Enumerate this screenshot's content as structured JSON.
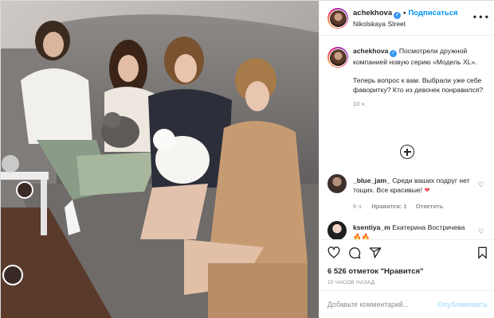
{
  "post": {
    "username": "achekhova",
    "follow_label": "Подписаться",
    "separator": "•",
    "location": "Nikolskaya Street",
    "more_label": "• • •"
  },
  "caption": {
    "username": "achekhova",
    "text1": "Посмотрели дружной компанией новую серию «Модель XL».",
    "text2": "Теперь вопрос к вам. Выбрали уже себе фаворитку? Кто из девочек понравился?",
    "time": "10 ч."
  },
  "comments": [
    {
      "username": "_blue_jam_",
      "text": "Среди ваших подруг нет тощих. Все красивые!",
      "emoji": "❤",
      "time": "6 ч.",
      "likes": "Нравится: 1",
      "reply": "Ответить"
    },
    {
      "username": "ksentiya_m",
      "text": "Екатерина Востричева",
      "emoji": "🔥🔥"
    }
  ],
  "actions": {
    "likes_text": "6 526 отметок \"Нравится\"",
    "time_ago": "10 ЧАСОВ НАЗАД"
  },
  "add_comment": {
    "placeholder": "Добавьте комментарий...",
    "post_label": "Опубликовать"
  },
  "colors": {
    "accent": "#0095f6",
    "verified": "#3897f0",
    "like_red": "#ed4956",
    "muted": "#8e8e8e"
  },
  "icons": [
    "heart-icon",
    "comment-icon",
    "share-icon",
    "bookmark-icon",
    "plus-circle-icon",
    "verified-icon",
    "more-icon"
  ]
}
